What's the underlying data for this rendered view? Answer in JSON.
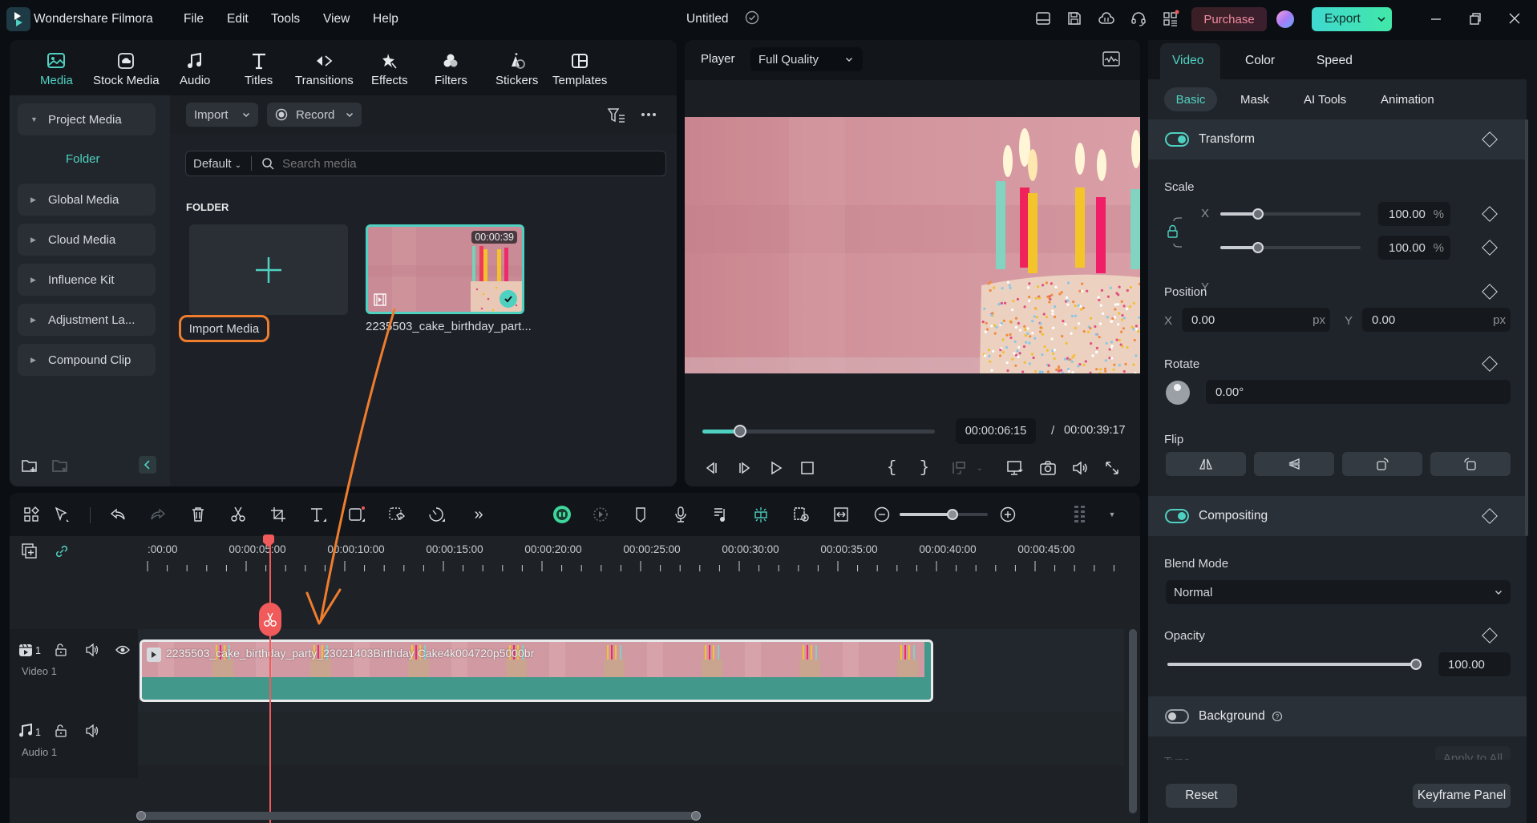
{
  "app": {
    "name": "Wondershare Filmora",
    "menu": [
      "File",
      "Edit",
      "Tools",
      "View",
      "Help"
    ],
    "document_title": "Untitled",
    "purchase_label": "Purchase",
    "export_label": "Export",
    "accent_color": "#4fd1c1"
  },
  "nav_tabs": [
    {
      "label": "Media",
      "icon": "media-icon",
      "active": true
    },
    {
      "label": "Stock Media",
      "icon": "stock-media-icon"
    },
    {
      "label": "Audio",
      "icon": "music-note-icon"
    },
    {
      "label": "Titles",
      "icon": "text-t-icon"
    },
    {
      "label": "Transitions",
      "icon": "transitions-icon"
    },
    {
      "label": "Effects",
      "icon": "effects-star-icon"
    },
    {
      "label": "Filters",
      "icon": "filters-circles-icon"
    },
    {
      "label": "Stickers",
      "icon": "stickers-icon"
    },
    {
      "label": "Templates",
      "icon": "templates-icon"
    }
  ],
  "sidebar": {
    "items": [
      {
        "label": "Project Media",
        "expanded": true
      },
      {
        "label": "Global Media"
      },
      {
        "label": "Cloud Media"
      },
      {
        "label": "Influence Kit"
      },
      {
        "label": "Adjustment La..."
      },
      {
        "label": "Compound Clip"
      }
    ],
    "folder_label": "Folder"
  },
  "media": {
    "import_label": "Import",
    "record_label": "Record",
    "sort_label": "Default",
    "search_placeholder": "Search media",
    "section_label": "FOLDER",
    "import_tile_label": "Import Media",
    "clip": {
      "name": "2235503_cake_birthday_part...",
      "duration": "00:00:39"
    }
  },
  "player": {
    "label": "Player",
    "quality": "Full Quality",
    "current_time": "00:00:06:15",
    "separator": "/",
    "total_time": "00:00:39:17",
    "progress_fraction": 0.163
  },
  "properties": {
    "tabs": [
      {
        "label": "Video",
        "active": true
      },
      {
        "label": "Color"
      },
      {
        "label": "Speed"
      }
    ],
    "subtabs": [
      {
        "label": "Basic",
        "active": true
      },
      {
        "label": "Mask"
      },
      {
        "label": "AI Tools"
      },
      {
        "label": "Animation"
      }
    ],
    "transform": {
      "title": "Transform",
      "enabled": true,
      "scale_label": "Scale",
      "scale_x_label": "X",
      "scale_y_label": "Y",
      "scale_x": "100.00",
      "scale_y": "100.00",
      "scale_unit": "%",
      "scale_slider_fraction": 0.27,
      "position_label": "Position",
      "pos_x_label": "X",
      "pos_y_label": "Y",
      "pos_x": "0.00",
      "pos_y": "0.00",
      "pos_unit": "px",
      "rotate_label": "Rotate",
      "rotate_value": "0.00°",
      "flip_label": "Flip"
    },
    "compositing": {
      "title": "Compositing",
      "enabled": true,
      "blend_label": "Blend Mode",
      "blend_value": "Normal",
      "opacity_label": "Opacity",
      "opacity_value": "100.00",
      "opacity_fraction": 1.0
    },
    "background": {
      "title": "Background",
      "enabled": false,
      "type_label": "Type",
      "apply_all_label": "Apply to All"
    },
    "reset_label": "Reset",
    "keyframe_label": "Keyframe Panel"
  },
  "timeline": {
    "ruler_labels": [
      ":00:00",
      "00:00:05:00",
      "00:00:10:00",
      "00:00:15:00",
      "00:00:20:00",
      "00:00:25:00",
      "00:00:30:00",
      "00:00:35:00",
      "00:00:40:00",
      "00:00:45:00"
    ],
    "zoom_fraction": 0.6,
    "tracks": [
      {
        "label": "Video 1",
        "number": "1",
        "type": "video"
      },
      {
        "label": "Audio 1",
        "number": "1",
        "type": "audio"
      }
    ],
    "clip_name": "2235503_cake_birthday_party_23021403Birthday Cake4k004720p5000br"
  },
  "annotation": {
    "color": "#f07d2d",
    "highlight_target": "Import Media"
  }
}
